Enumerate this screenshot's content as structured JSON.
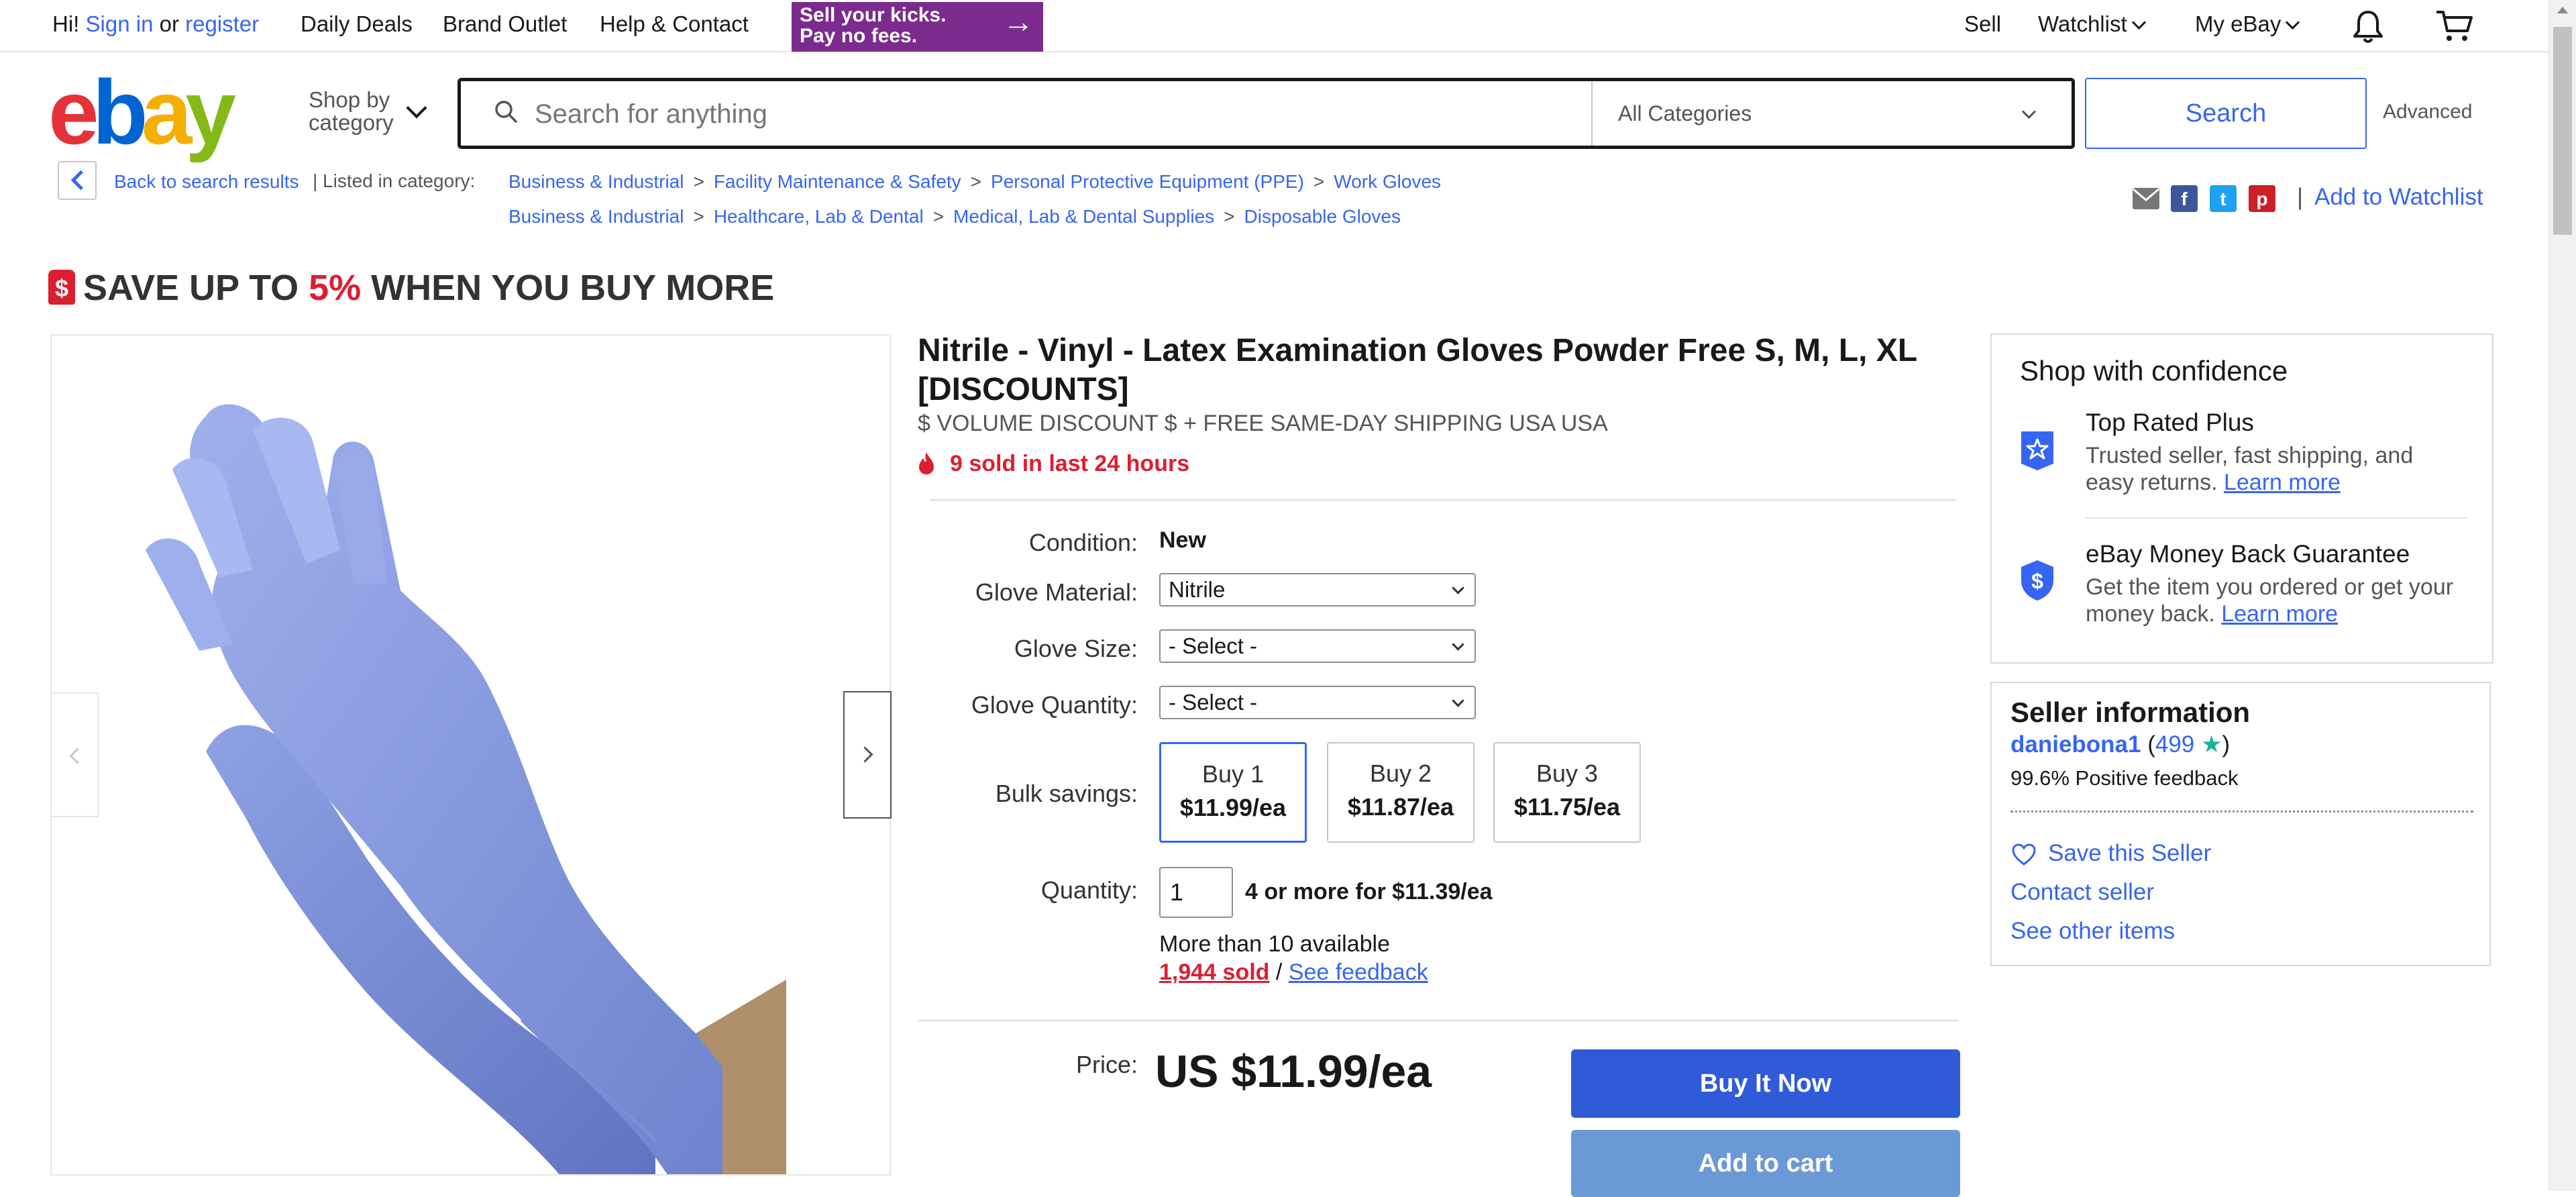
{
  "topbar": {
    "greeting": "Hi!",
    "sign_in": "Sign in",
    "or": "or",
    "register": "register",
    "daily_deals": "Daily Deals",
    "brand_outlet": "Brand Outlet",
    "help_contact": "Help & Contact",
    "sell_banner_line1": "Sell your kicks.",
    "sell_banner_line2": "Pay no fees.",
    "sell": "Sell",
    "watchlist": "Watchlist",
    "my_ebay": "My eBay"
  },
  "header": {
    "logo": {
      "e": "e",
      "b": "b",
      "a": "a",
      "y": "y"
    },
    "shop_by_line1": "Shop by",
    "shop_by_line2": "category",
    "search_placeholder": "Search for anything",
    "category_selected": "All Categories",
    "search_button": "Search",
    "advanced": "Advanced"
  },
  "breadcrumb": {
    "back": "Back to search results",
    "listed_in": "| Listed in category:",
    "path1": [
      "Business & Industrial",
      "Facility Maintenance & Safety",
      "Personal Protective Equipment (PPE)",
      "Work Gloves"
    ],
    "path2": [
      "Business & Industrial",
      "Healthcare, Lab & Dental",
      "Medical, Lab & Dental Supplies",
      "Disposable Gloves"
    ],
    "separator": ">",
    "add_to_watchlist": "Add to Watchlist",
    "share_sep": "|"
  },
  "promo": {
    "before": "SAVE UP TO ",
    "percent": "5%",
    "after": " WHEN YOU BUY MORE",
    "tag_icon": "$"
  },
  "item": {
    "title": "Nitrile - Vinyl - Latex Examination Gloves Powder Free S, M, L, XL [DISCOUNTS]",
    "subtitle": "$ VOLUME DISCOUNT $ + FREE SAME-DAY SHIPPING USA USA",
    "sold_24h": "9 sold in last 24 hours",
    "condition_label": "Condition:",
    "condition_value": "New",
    "material_label": "Glove Material:",
    "material_value": "Nitrile",
    "size_label": "Glove Size:",
    "size_value": "- Select -",
    "quantity_sel_label": "Glove Quantity:",
    "quantity_sel_value": "- Select -",
    "bulk_label": "Bulk savings:",
    "bulk_options": [
      {
        "qty": "Buy 1",
        "price": "$11.99/ea"
      },
      {
        "qty": "Buy 2",
        "price": "$11.87/ea"
      },
      {
        "qty": "Buy 3",
        "price": "$11.75/ea"
      }
    ],
    "quantity_label": "Quantity:",
    "quantity_value": "1",
    "quantity_note": "4 or more for $11.39/ea",
    "available": "More than 10 available",
    "sold_count": "1,944 sold",
    "sold_sep": " / ",
    "see_feedback": "See feedback",
    "price_label": "Price:",
    "price_value": "US $11.99/ea",
    "buy_now": "Buy It Now",
    "add_to_cart": "Add to cart"
  },
  "confidence": {
    "title": "Shop with confidence",
    "top_rated_title": "Top Rated Plus",
    "top_rated_text": "Trusted seller, fast shipping, and easy returns.",
    "money_back_title": "eBay Money Back Guarantee",
    "money_back_text": "Get the item you ordered or get your money back.",
    "learn_more": "Learn more"
  },
  "seller": {
    "title": "Seller information",
    "name": "daniebona1",
    "score": "499",
    "open_paren": " (",
    "close_paren": ")",
    "star": "★",
    "positive": "99.6% Positive feedback",
    "save_seller": "Save this Seller",
    "contact": "Contact seller",
    "other_items": "See other items"
  },
  "colors": {
    "accent": "#3665f3",
    "sale_red": "#dd1e31",
    "banner_purple": "#7b2b8e",
    "buy_button": "#2f5bd8",
    "cart_button": "#6b99d6"
  }
}
